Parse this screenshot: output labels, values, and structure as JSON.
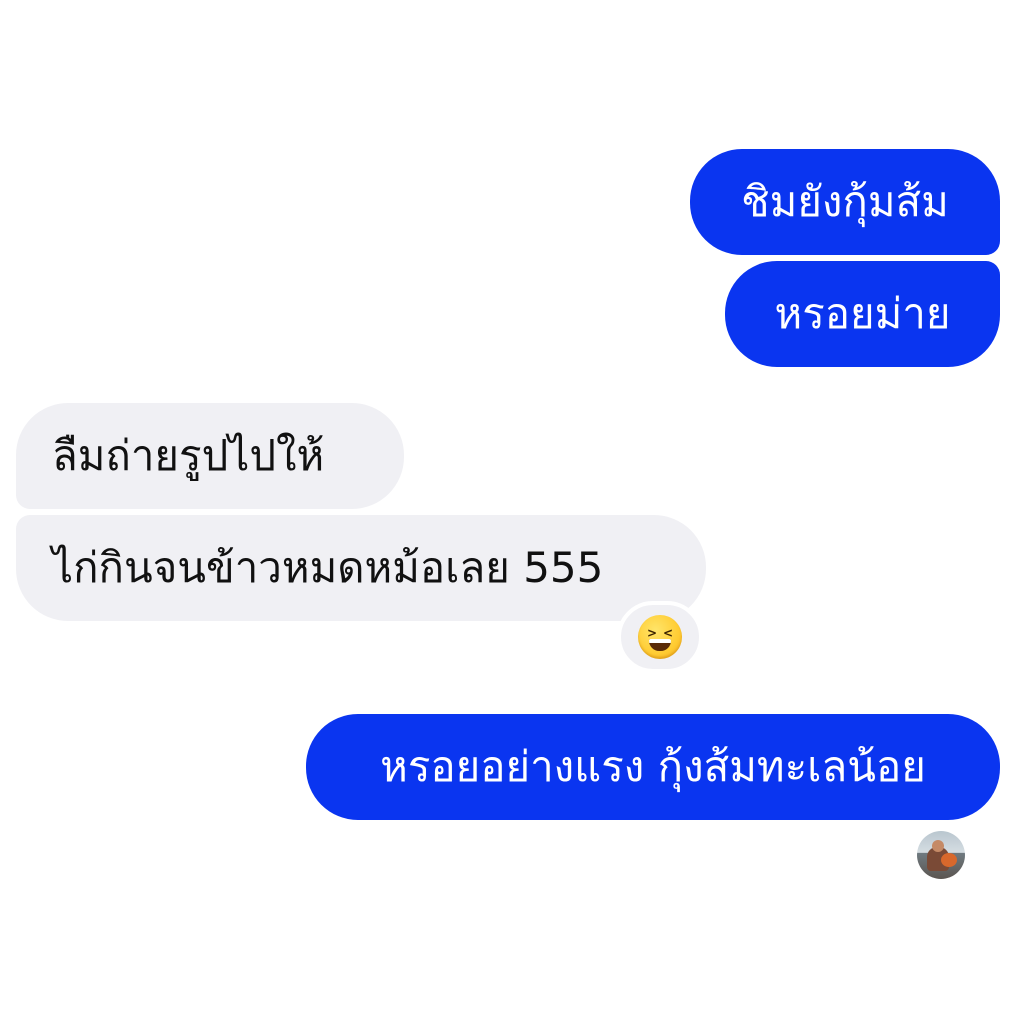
{
  "messages": [
    {
      "direction": "outgoing",
      "text": "ชิมยังกุ้มส้ม"
    },
    {
      "direction": "outgoing",
      "text": "หรอยม่าย"
    },
    {
      "direction": "incoming",
      "text": "ลืมถ่ายรูปไปให้"
    },
    {
      "direction": "incoming",
      "text": "ไก่กินจนข้าวหมดหม้อเลย 555",
      "reaction": "laughing-squint-emoji"
    },
    {
      "direction": "outgoing",
      "text": "หรอยอย่างแรง กุ้งส้มทะเลน้อย",
      "read_receipt": "avatar"
    }
  ],
  "colors": {
    "outgoing_bubble": "#0a35f0",
    "incoming_bubble": "#f0f0f4",
    "outgoing_text": "#ffffff",
    "incoming_text": "#111111"
  },
  "icons": {
    "reaction": "laughing-squint-emoji",
    "read_receipt": "seen-avatar"
  }
}
